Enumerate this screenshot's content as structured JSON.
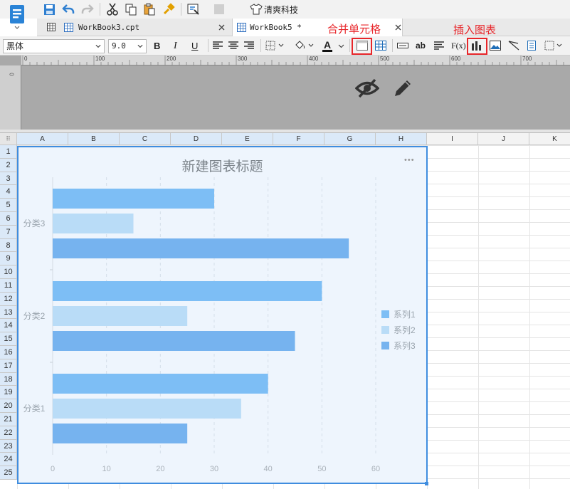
{
  "toolbar1": {
    "font_button_label": "清爽科技"
  },
  "tabs": [
    {
      "label": "WorkBook3.cpt"
    },
    {
      "label": "WorkBook5 *"
    }
  ],
  "annotations": {
    "merge_cells": "合并单元格",
    "insert_chart": "插入图表"
  },
  "toolbar2": {
    "font_family": "黑体",
    "font_size": "9.0",
    "bold": "B",
    "italic": "I",
    "underline": "U",
    "text_color_letter": "A",
    "formula_label": "F(x)",
    "ab_label": "ab"
  },
  "ruler": {
    "ticks": [
      "0",
      "100",
      "200",
      "300",
      "400",
      "500",
      "600",
      "700"
    ]
  },
  "columns": [
    "A",
    "B",
    "C",
    "D",
    "E",
    "F",
    "G",
    "H",
    "I",
    "J",
    "K"
  ],
  "rows": [
    "1",
    "2",
    "3",
    "4",
    "5",
    "6",
    "7",
    "8",
    "9",
    "10",
    "11",
    "12",
    "13",
    "14",
    "15",
    "16",
    "17",
    "18",
    "19",
    "20",
    "21",
    "22",
    "23",
    "24",
    "25"
  ],
  "colors": {
    "accent_blue": "#3f8ddf",
    "annotation_red": "#e8262a",
    "series1": "#7dbef5",
    "series2": "#b9dcf7",
    "series3": "#76b3ef"
  },
  "chart_data": {
    "type": "bar",
    "orientation": "horizontal",
    "title": "新建图表标题",
    "categories": [
      "分类1",
      "分类2",
      "分类3"
    ],
    "series": [
      {
        "name": "系列1",
        "values": [
          40,
          50,
          30
        ]
      },
      {
        "name": "系列2",
        "values": [
          35,
          25,
          15
        ]
      },
      {
        "name": "系列3",
        "values": [
          25,
          45,
          55
        ]
      }
    ],
    "xlim": [
      0,
      60
    ],
    "xticks": [
      "0",
      "10",
      "20",
      "30",
      "40",
      "50",
      "60"
    ],
    "legend": "right",
    "grid": true,
    "more_label": "•••"
  }
}
